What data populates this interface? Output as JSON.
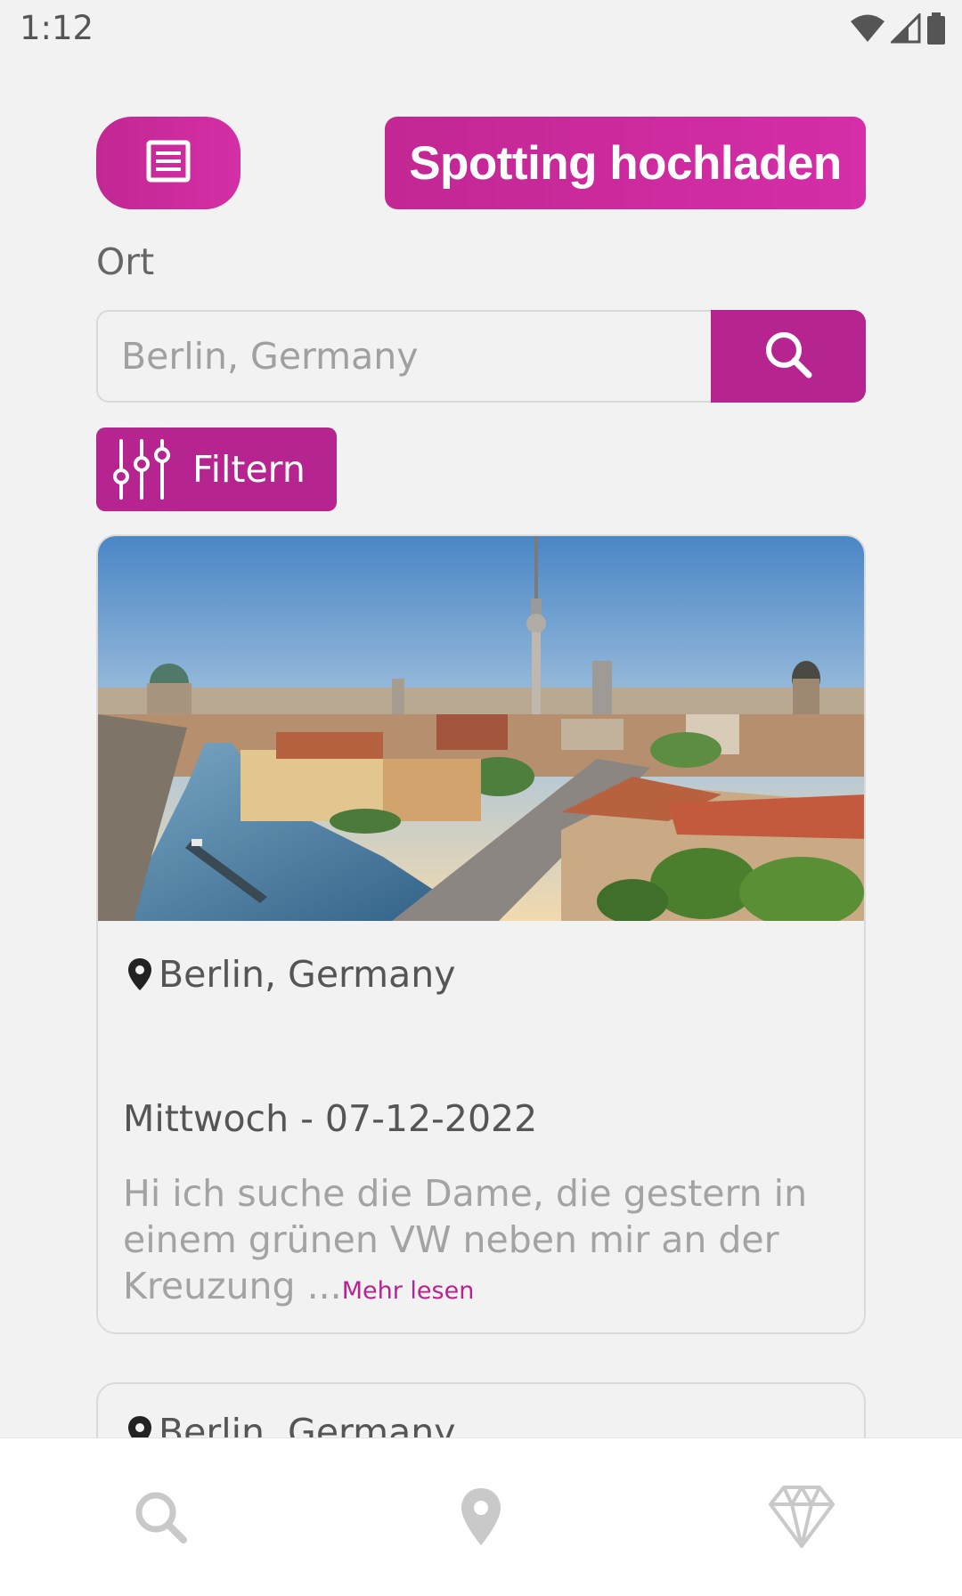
{
  "status_bar": {
    "time": "1:12"
  },
  "header": {
    "upload_label": "Spotting hochladen"
  },
  "search": {
    "location_label": "Ort",
    "placeholder": "Berlin, Germany"
  },
  "filter": {
    "label": "Filtern"
  },
  "posts": [
    {
      "location": "Berlin, Germany",
      "date": "Mittwoch - 07-12-2022",
      "text": "Hi ich suche die Dame, die gestern in einem grünen VW neben mir an der Kreuzung ...",
      "more_label": "Mehr lesen"
    },
    {
      "location": "Berlin, Germany"
    }
  ],
  "colors": {
    "accent": "#b5248f",
    "accent_light": "#d52ea8",
    "background": "#f2f2f2",
    "nav_icon": "#c9c9c9"
  },
  "icons": {
    "list_button": "list-icon",
    "search_button": "search-icon",
    "filter_button": "sliders-icon",
    "location": "map-pin-icon",
    "nav": [
      "search-icon",
      "map-pin-icon",
      "diamond-icon"
    ]
  }
}
